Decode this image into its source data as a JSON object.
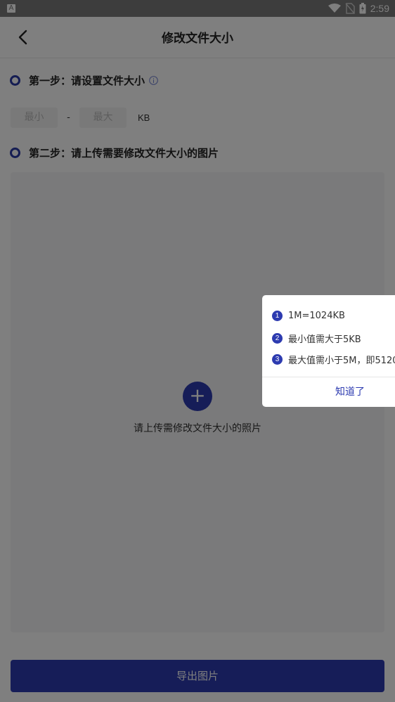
{
  "status_bar": {
    "app_badge": "A",
    "time": "2:59"
  },
  "header": {
    "title": "修改文件大小"
  },
  "step1": {
    "label": "第一步：请设置文件大小"
  },
  "size": {
    "min_placeholder": "最小",
    "separator": "-",
    "max_placeholder": "最大",
    "unit": "KB"
  },
  "step2": {
    "label": "第二步：请上传需要修改文件大小的图片"
  },
  "upload": {
    "plus": "+",
    "hint": "请上传需修改文件大小的照片"
  },
  "export": {
    "label": "导出图片"
  },
  "popup": {
    "tips": [
      {
        "num": "1",
        "text": "1M=1024KB"
      },
      {
        "num": "2",
        "text": "最小值需大于5KB"
      },
      {
        "num": "3",
        "text": "最大值需小于5M，即5120"
      }
    ],
    "confirm": "知道了"
  },
  "colors": {
    "accent": "#2d3bb0"
  }
}
